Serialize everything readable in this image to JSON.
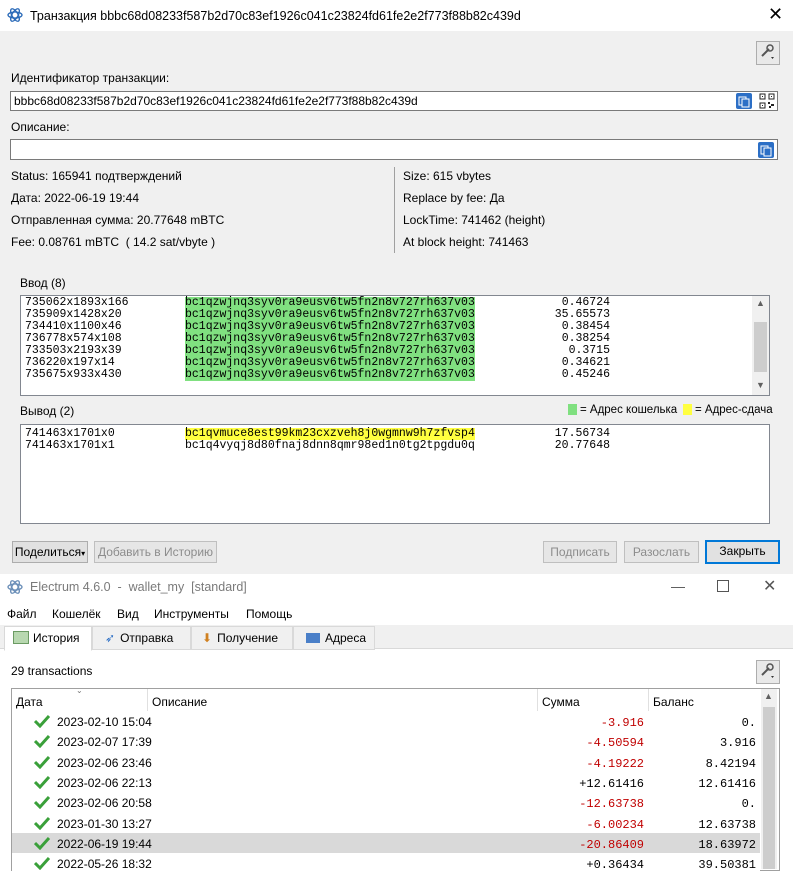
{
  "tx_window": {
    "title": "Транзакция bbbc68d08233f587b2d70c83ef1926c041c23824fd61fe2e2f773f88b82c439d",
    "txid_label": "Идентификатор транзакции:",
    "txid_value": "bbbc68d08233f587b2d70c83ef1926c041c23824fd61fe2e2f773f88b82c439d",
    "description_label": "Описание:",
    "description_value": "",
    "info_left": [
      "Status: 165941 подтверждений",
      "Дата: 2022-06-19 19:44",
      "Отправленная сумма: 20.77648 mBTC",
      "Fee: 0.08761 mBTC  ( 14.2 sat/vbyte )"
    ],
    "info_right": [
      "Size: 615 vbytes",
      "Replace by fee: Да",
      "LockTime: 741462 (height)",
      "At block height: 741463"
    ],
    "inputs_label": "Ввод (8)",
    "inputs": [
      {
        "outpoint": "735062x1893x166",
        "address": "bc1qzwjnq3syv0ra9eusv6tw5fn2n8v727rh637v03",
        "amount": "0.46724"
      },
      {
        "outpoint": "735909x1428x20",
        "address": "bc1qzwjnq3syv0ra9eusv6tw5fn2n8v727rh637v03",
        "amount": "35.65573"
      },
      {
        "outpoint": "734410x1100x46",
        "address": "bc1qzwjnq3syv0ra9eusv6tw5fn2n8v727rh637v03",
        "amount": "0.38454"
      },
      {
        "outpoint": "736778x574x108",
        "address": "bc1qzwjnq3syv0ra9eusv6tw5fn2n8v727rh637v03",
        "amount": "0.38254"
      },
      {
        "outpoint": "733503x2193x39",
        "address": "bc1qzwjnq3syv0ra9eusv6tw5fn2n8v727rh637v03",
        "amount": "0.3715"
      },
      {
        "outpoint": "736220x197x14",
        "address": "bc1qzwjnq3syv0ra9eusv6tw5fn2n8v727rh637v03",
        "amount": "0.34621"
      },
      {
        "outpoint": "735675x933x430",
        "address": "bc1qzwjnq3syv0ra9eusv6tw5fn2n8v727rh637v03",
        "amount": "0.45246"
      }
    ],
    "outputs_label": "Вывод (2)",
    "legend_wallet": "= Адрес кошелька",
    "legend_change": "= Адрес-сдача",
    "outputs": [
      {
        "outpoint": "741463x1701x0",
        "address": "bc1qvmuce8est99km23cxzveh8j0wgmnw9h7zfvsp4",
        "amount": "17.56734"
      },
      {
        "outpoint": "741463x1701x1",
        "address": "bc1q4vyqj8d80fnaj8dnn8qmr98ed1n0tg2tpgdu0q",
        "amount": "20.77648"
      }
    ],
    "buttons": {
      "share": "Поделиться",
      "add_history": "Добавить в Историю",
      "sign": "Подписать",
      "broadcast": "Разослать",
      "close": "Закрыть"
    }
  },
  "main_window": {
    "title": "Electrum 4.6.0  -  wallet_my  [standard]",
    "menu": [
      "Файл",
      "Кошелёк",
      "Вид",
      "Инструменты",
      "Помощь"
    ],
    "tabs": [
      "История",
      "Отправка",
      "Получение",
      "Адреса"
    ],
    "tx_count": "29 transactions",
    "columns": [
      "Дата",
      "Описание",
      "Сумма",
      "Баланс"
    ],
    "rows": [
      {
        "date": "2023-02-10 15:04",
        "amount": "-3.916",
        "balance": "0."
      },
      {
        "date": "2023-02-07 17:39",
        "amount": "-4.50594",
        "balance": "3.916"
      },
      {
        "date": "2023-02-06 23:46",
        "amount": "-4.19222",
        "balance": "8.42194"
      },
      {
        "date": "2023-02-06 22:13",
        "amount": "+12.61416",
        "balance": "12.61416"
      },
      {
        "date": "2023-02-06 20:58",
        "amount": "-12.63738",
        "balance": "0."
      },
      {
        "date": "2023-01-30 13:27",
        "amount": "-6.00234",
        "balance": "12.63738"
      },
      {
        "date": "2022-06-19 19:44",
        "amount": "-20.86409",
        "balance": "18.63972"
      },
      {
        "date": "2022-05-26 18:32",
        "amount": "+0.36434",
        "balance": "39.50381"
      }
    ]
  },
  "colors": {
    "wallet_highlight": "#80e080",
    "change_highlight": "#ffff40",
    "negative_amount": "#c00000",
    "accent": "#0078d7"
  }
}
